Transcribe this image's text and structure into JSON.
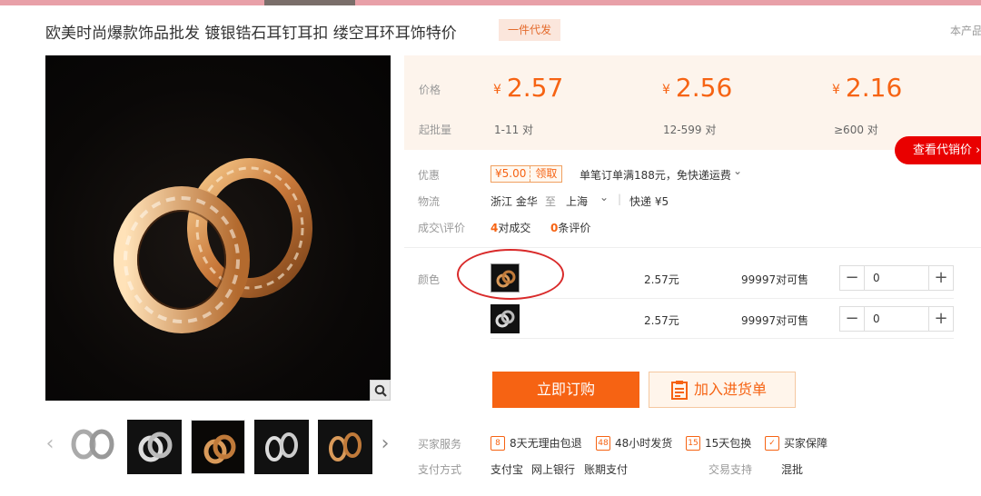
{
  "product": {
    "title": "欧美时尚爆款饰品批发 镀银锆石耳钉耳扣 缕空耳环耳饰特价",
    "badge": "一件代发",
    "title_right": "本产品"
  },
  "price": {
    "price_label": "价格",
    "qty_label": "起批量",
    "currency": "¥",
    "tiers": [
      {
        "price": "2.57",
        "range": "1-11 对"
      },
      {
        "price": "2.56",
        "range": "12-599 对"
      },
      {
        "price": "2.16",
        "range": "≥600 对"
      }
    ],
    "agent_button": "查看代销价 ›"
  },
  "promo": {
    "label": "优惠",
    "coupon_amount": "¥5.00",
    "coupon_get": "领取",
    "text": "单笔订单满188元，免快递运费",
    "chevron": "⌄"
  },
  "logistics": {
    "label": "物流",
    "from": "浙江 金华",
    "to_word": "至",
    "to": "上海",
    "chevron": "⌄",
    "sep": "|",
    "express": "快递 ¥5"
  },
  "deals": {
    "label": "成交\\评价",
    "deal_count": "4",
    "deal_text": "对成交",
    "review_count": "0",
    "review_text": "条评价"
  },
  "sku": {
    "label": "颜色",
    "rows": [
      {
        "price": "2.57元",
        "stock": "99997对可售",
        "qty": "0"
      },
      {
        "price": "2.57元",
        "stock": "99997对可售",
        "qty": "0"
      }
    ],
    "minus": "−",
    "plus": "+"
  },
  "actions": {
    "buy": "立即订购",
    "cart": "加入进货单"
  },
  "service": {
    "label": "买家服务",
    "items": [
      {
        "icon": "8",
        "text": "8天无理由包退"
      },
      {
        "icon": "48",
        "text": "48小时发货"
      },
      {
        "icon": "15",
        "text": "15天包换"
      },
      {
        "icon": "✓",
        "text": "买家保障"
      }
    ]
  },
  "payment": {
    "label": "支付方式",
    "methods": [
      "支付宝",
      "网上银行",
      "账期支付"
    ],
    "trade_label": "交易支持",
    "trade_value": "混批"
  },
  "thumbs": {
    "prev": "‹",
    "next": "›"
  },
  "colors": {
    "accent": "#f66313",
    "red": "#e90000",
    "price_bg": "#fdf4ec"
  }
}
